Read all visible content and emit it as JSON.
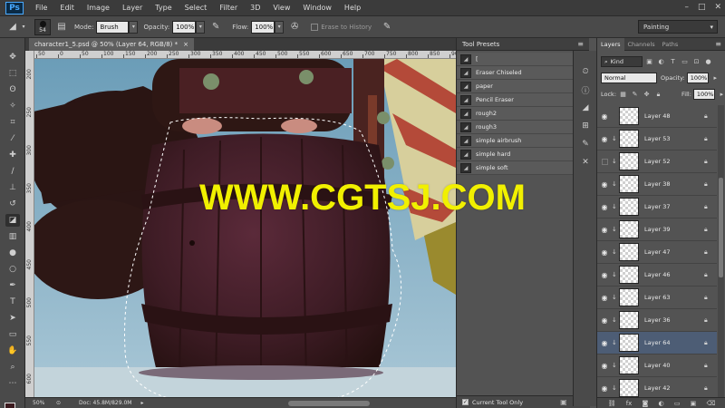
{
  "menubar": {
    "logo": "Ps",
    "items": [
      "File",
      "Edit",
      "Image",
      "Layer",
      "Type",
      "Select",
      "Filter",
      "3D",
      "View",
      "Window",
      "Help"
    ]
  },
  "options": {
    "brush_size": "54",
    "mode_label": "Mode:",
    "mode_value": "Brush",
    "opacity_label": "Opacity:",
    "opacity_value": "100%",
    "flow_label": "Flow:",
    "flow_value": "100%",
    "erase_history": "Erase to History",
    "workspace": "Painting"
  },
  "document": {
    "tab_title": "character1_5.psd @ 50% (Layer 64, RGB/8) *",
    "close": "×",
    "ruler_top": [
      "50",
      "0",
      "50",
      "100",
      "150",
      "200",
      "250",
      "300",
      "350",
      "400",
      "450",
      "500",
      "550",
      "600",
      "650",
      "700",
      "750",
      "800",
      "850",
      "900"
    ],
    "ruler_left": [
      "200",
      "250",
      "300",
      "350",
      "400",
      "450",
      "500",
      "550",
      "600"
    ],
    "zoom": "50%",
    "doc_info": "Doc: 45.8M/829.0M",
    "watermark": "WWW.CGTSJ.COM"
  },
  "tool_presets": {
    "title": "Tool Presets",
    "items": [
      "[",
      "Eraser Chiseled",
      "paper",
      "Pencil Eraser",
      "rough2",
      "rough3",
      "simple airbrush",
      "simple hard",
      "simple soft"
    ],
    "current_tool_only": "Current Tool Only"
  },
  "layers_panel": {
    "tabs": [
      "Layers",
      "Channels",
      "Paths"
    ],
    "filter": "Kind",
    "blend_mode": "Normal",
    "opacity_label": "Opacity:",
    "opacity_value": "100%",
    "lock_label": "Lock:",
    "fill_label": "Fill:",
    "fill_value": "100%",
    "layers": [
      {
        "name": "Layer 48",
        "visible": true,
        "clipped": false,
        "selected": false
      },
      {
        "name": "Layer 53",
        "visible": true,
        "clipped": true,
        "selected": false
      },
      {
        "name": "Layer 52",
        "visible": false,
        "clipped": true,
        "selected": false
      },
      {
        "name": "Layer 38",
        "visible": true,
        "clipped": true,
        "selected": false
      },
      {
        "name": "Layer 37",
        "visible": true,
        "clipped": true,
        "selected": false
      },
      {
        "name": "Layer 39",
        "visible": true,
        "clipped": true,
        "selected": false
      },
      {
        "name": "Layer 47",
        "visible": true,
        "clipped": true,
        "selected": false
      },
      {
        "name": "Layer 46",
        "visible": true,
        "clipped": true,
        "selected": false
      },
      {
        "name": "Layer 63",
        "visible": true,
        "clipped": true,
        "selected": false
      },
      {
        "name": "Layer 36",
        "visible": true,
        "clipped": true,
        "selected": false
      },
      {
        "name": "Layer 64",
        "visible": true,
        "clipped": true,
        "selected": true
      },
      {
        "name": "Layer 40",
        "visible": true,
        "clipped": true,
        "selected": false
      },
      {
        "name": "Layer 42",
        "visible": true,
        "clipped": true,
        "selected": false
      }
    ]
  },
  "colors": {
    "foreground": "#3b1a1e",
    "background": "#ffffff",
    "selected_layer": "#4d5d75",
    "watermark": "#f1f000"
  },
  "icons": {
    "tools": [
      "move-icon",
      "marquee-icon",
      "lasso-icon",
      "quick-select-icon",
      "crop-icon",
      "eyedropper-icon",
      "healing-icon",
      "brush-icon",
      "clone-stamp-icon",
      "history-brush-icon",
      "eraser-icon",
      "gradient-icon",
      "blur-icon",
      "dodge-icon",
      "pen-icon",
      "type-icon",
      "path-select-icon",
      "shape-icon",
      "hand-icon",
      "zoom-icon"
    ]
  }
}
